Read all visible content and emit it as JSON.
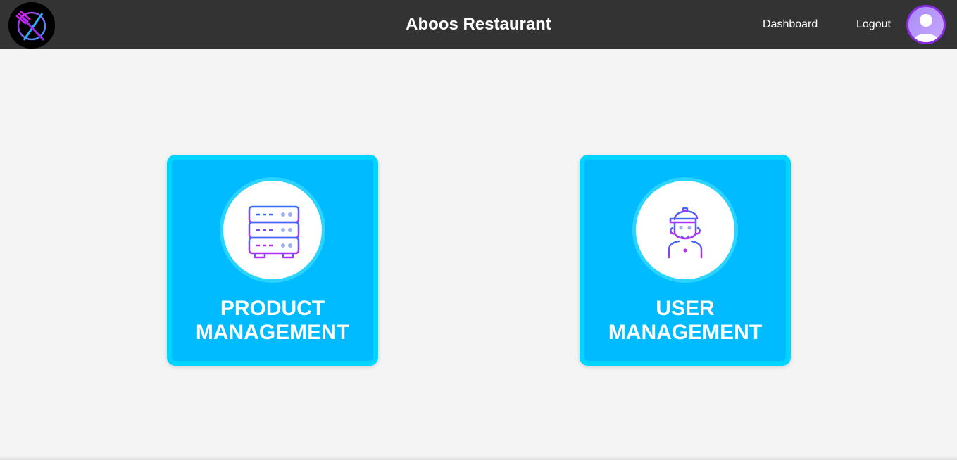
{
  "header": {
    "brand": "Aboos Restaurant",
    "nav": {
      "dashboard": "Dashboard",
      "logout": "Logout"
    },
    "logo_icon": "restaurant-plate-fork-knife-icon",
    "avatar_icon": "user-avatar-icon"
  },
  "cards": {
    "product": {
      "line1": "PRODUCT",
      "line2": "MANAGEMENT",
      "icon": "server-stack-icon"
    },
    "user": {
      "line1": "USER",
      "line2": "MANAGEMENT",
      "icon": "person-cap-icon"
    }
  },
  "colors": {
    "navbar": "#333333",
    "card_bg": "#00bbff",
    "card_border": "#00d4ff",
    "icon_gradient_start": "#3b6cf6",
    "icon_gradient_end": "#b22df5"
  }
}
